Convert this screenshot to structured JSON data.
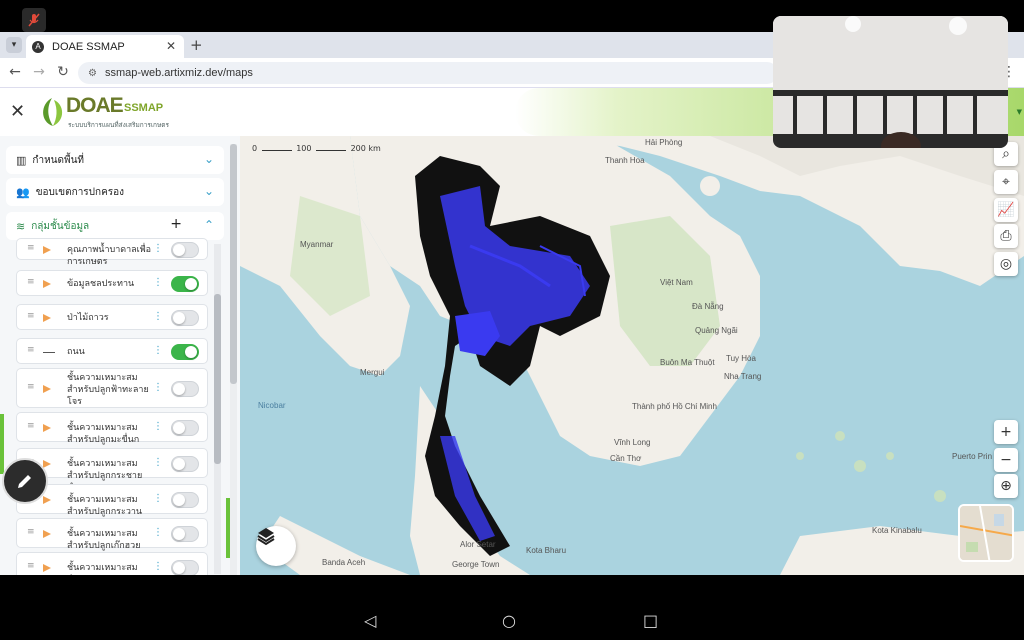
{
  "browser": {
    "tab_title": "DOAE SSMAP",
    "url": "ssmap-web.artixmiz.dev/maps"
  },
  "header": {
    "brand": "DOAE",
    "brand_suffix": "SSMAP",
    "tagline": "ระบบบริการแผนที่ส่งเสริมการเกษตร"
  },
  "sidebar": {
    "sections": [
      {
        "label": "กำหนดพื้นที่",
        "icon": "map-icon"
      },
      {
        "label": "ขอบเขตการปกครอง",
        "icon": "users-icon"
      },
      {
        "label": "กลุ่มชั้นข้อมูล",
        "icon": "layers-icon"
      }
    ],
    "layers": [
      {
        "label": "คุณภาพน้ำบาดาลเพื่อการเกษตร",
        "symbol": "triangle",
        "enabled": false
      },
      {
        "label": "ข้อมูลชลประทาน",
        "symbol": "triangle",
        "enabled": true
      },
      {
        "label": "ป่าไม้ถาวร",
        "symbol": "triangle",
        "enabled": false
      },
      {
        "label": "ถนน",
        "symbol": "line",
        "enabled": true
      },
      {
        "label": "ชั้นความเหมาะสมสำหรับปลูกฟ้าทะลายโจร",
        "symbol": "triangle",
        "enabled": false
      },
      {
        "label": "ชั้นความเหมาะสมสำหรับปลูกมะขื่นก",
        "symbol": "triangle",
        "enabled": false
      },
      {
        "label": "ชั้นความเหมาะสมสำหรับปลูกกระชายดำ",
        "symbol": "triangle",
        "enabled": false
      },
      {
        "label": "ชั้นความเหมาะสมสำหรับปลูกกระวาน",
        "symbol": "triangle",
        "enabled": false
      },
      {
        "label": "ชั้นความเหมาะสมสำหรับปลูกเก๊กฮวย",
        "symbol": "triangle",
        "enabled": false
      },
      {
        "label": "ชั้นความเหมาะสมสำหรับปลูกเพชรสังฆาต",
        "symbol": "triangle",
        "enabled": false
      }
    ]
  },
  "map": {
    "scale_labels": [
      "0",
      "100",
      "200 km"
    ],
    "labels": {
      "hanoi": "Thanh Hoa",
      "haiphong": "Hải Phòng",
      "vietnam": "Việt Nam",
      "danang": "Đà Nẵng",
      "quangngai": "Quảng Ngãi",
      "buonmathuot": "Buôn Ma Thuột",
      "tuyhoa": "Tuy Hòa",
      "hcmc": "Thành phố Hồ Chí Minh",
      "vinhlong": "Vĩnh Long",
      "cantho": "Cần Thơ",
      "nhatrang": "Nha Trang",
      "myanmar": "Myanmar",
      "bandaaceh": "Banda Aceh",
      "georgetown": "George Town",
      "alorsetar": "Alor Setar",
      "kotabharu": "Kota Bharu",
      "kotakinabalu": "Kota Kinabalu",
      "puertoprincesa": "Puerto Prin",
      "mergui": "Mergui",
      "nicobar": "Nicobar"
    },
    "zoom_in": "+",
    "zoom_out": "−"
  },
  "colors": {
    "accent_green": "#3bb54a",
    "data_blue": "#3a3af0",
    "road_black": "#111111",
    "sea": "#aad3df",
    "land": "#f2efe9"
  }
}
